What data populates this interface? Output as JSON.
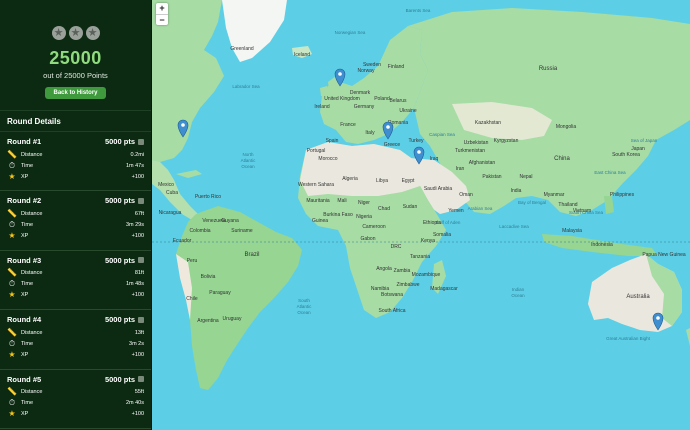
{
  "summary": {
    "stars": 3,
    "score": "25000",
    "subtitle": "out of 25000 Points",
    "back_button": "Back to History"
  },
  "details_title": "Round Details",
  "labels": {
    "distance": "Distance",
    "time": "Time",
    "xp": "XP"
  },
  "rounds": [
    {
      "title": "Round #1",
      "points": "5000 pts",
      "distance": "0.2mi",
      "time": "1m 47s",
      "xp": "+100"
    },
    {
      "title": "Round #2",
      "points": "5000 pts",
      "distance": "67ft",
      "time": "3m 29s",
      "xp": "+100"
    },
    {
      "title": "Round #3",
      "points": "5000 pts",
      "distance": "81ft",
      "time": "1m 48s",
      "xp": "+100"
    },
    {
      "title": "Round #4",
      "points": "5000 pts",
      "distance": "13ft",
      "time": "3m 2s",
      "xp": "+100"
    },
    {
      "title": "Round #5",
      "points": "5000 pts",
      "distance": "55ft",
      "time": "2m 40s",
      "xp": "+100"
    }
  ],
  "map": {
    "zoom_in": "+",
    "zoom_out": "−",
    "oceans": {
      "north_atlantic_1": "North",
      "north_atlantic_2": "Atlantic",
      "north_atlantic_3": "Ocean",
      "south_atlantic_1": "South",
      "south_atlantic_2": "Atlantic",
      "south_atlantic_3": "Ocean",
      "indian_1": "Indian",
      "indian_2": "Ocean"
    },
    "places": {
      "greenland": "Greenland",
      "iceland": "Iceland",
      "russia": "Russia",
      "kazakhstan": "Kazakhstan",
      "mongolia": "Mongolia",
      "china": "China",
      "india": "India",
      "iran": "Iran",
      "saudi_arabia": "Saudi Arabia",
      "egypt": "Egypt",
      "libya": "Libya",
      "algeria": "Algeria",
      "mali": "Mali",
      "niger": "Niger",
      "chad": "Chad",
      "sudan": "Sudan",
      "ethiopia": "Ethiopia",
      "drc": "DRC",
      "tanzania": "Tanzania",
      "angola": "Angola",
      "namibia": "Namibia",
      "south_africa": "South Africa",
      "madagascar": "Madagascar",
      "venezuela": "Venezuela",
      "colombia": "Colombia",
      "peru": "Peru",
      "bolivia": "Bolivia",
      "brazil": "Brazil",
      "chile": "Chile",
      "argentina": "Argentina",
      "paraguay": "Paraguay",
      "uruguay": "Uruguay",
      "mexico": "Mexico",
      "cuba": "Cuba",
      "australia": "Australia",
      "indonesia": "Indonesia",
      "japan": "Japan",
      "sweden": "Sweden",
      "norway": "Norway",
      "finland": "Finland",
      "france": "France",
      "spain": "Spain",
      "germany": "Germany",
      "ukraine": "Ukraine",
      "turkey": "Turkey",
      "iraq": "Iraq",
      "pakistan": "Pakistan",
      "afghanistan": "Afghanistan",
      "thailand": "Thailand",
      "vietnam": "Vietnam",
      "philippines": "Philippines",
      "malaysia": "Malaysia",
      "papua": "Papua New Guinea",
      "somalia": "Somalia",
      "nigeria": "Nigeria",
      "united_kingdom": "United Kingdom",
      "poland": "Poland",
      "greece": "Greece",
      "morocco": "Morocco",
      "yemen": "Yemen",
      "oman": "Oman",
      "kenya": "Kenya",
      "zambia": "Zambia",
      "mozambique": "Mozambique",
      "botswana": "Botswana",
      "zimbabwe": "Zimbabwe",
      "nepal": "Nepal",
      "myanmar": "Myanmar",
      "ecuador": "Ecuador",
      "guyana": "Guyana",
      "suriname": "Suriname",
      "nicaragua": "Nicaragua",
      "puerto_rico": "Puerto Rico",
      "ireland": "Ireland",
      "denmark": "Denmark",
      "belarus": "Belarus",
      "romania": "Romania",
      "italy": "Italy",
      "portugal": "Portugal",
      "mauritania": "Mauritania",
      "western_sahara": "Western Sahara",
      "burkina_faso": "Burkina Faso",
      "guinea": "Guinea",
      "cameroon": "Cameroon",
      "gabon": "Gabon",
      "uzbekistan": "Uzbekistan",
      "turkmenistan": "Turkmenistan",
      "kyrgyzstan": "Kyrgyzstan",
      "south_korea": "South Korea",
      "east_china_sea": "East China Sea",
      "south_china_sea": "South China Sea",
      "bay_of_bengal": "Bay of Bengal",
      "arabian_sea": "Arabian Sea",
      "laccadive": "Laccadive Sea",
      "sea_of_japan": "Sea of Japan",
      "great_australian_bight": "Great Australian Bight",
      "labrador_sea": "Labrador Sea",
      "norwegian_sea": "Norwegian Sea",
      "barents_sea": "Barents Sea",
      "caspian_sea": "Caspian Sea",
      "gulf_of_aden": "Gulf of Aden"
    },
    "pins": [
      {
        "name": "pin-united-kingdom"
      },
      {
        "name": "pin-new-york"
      },
      {
        "name": "pin-greece"
      },
      {
        "name": "pin-israel"
      },
      {
        "name": "pin-melbourne"
      }
    ],
    "colors": {
      "ocean": "#5ccfe6",
      "land": "#a7dca5",
      "desert": "#eae8de",
      "pin": "#3f8fd0"
    }
  }
}
